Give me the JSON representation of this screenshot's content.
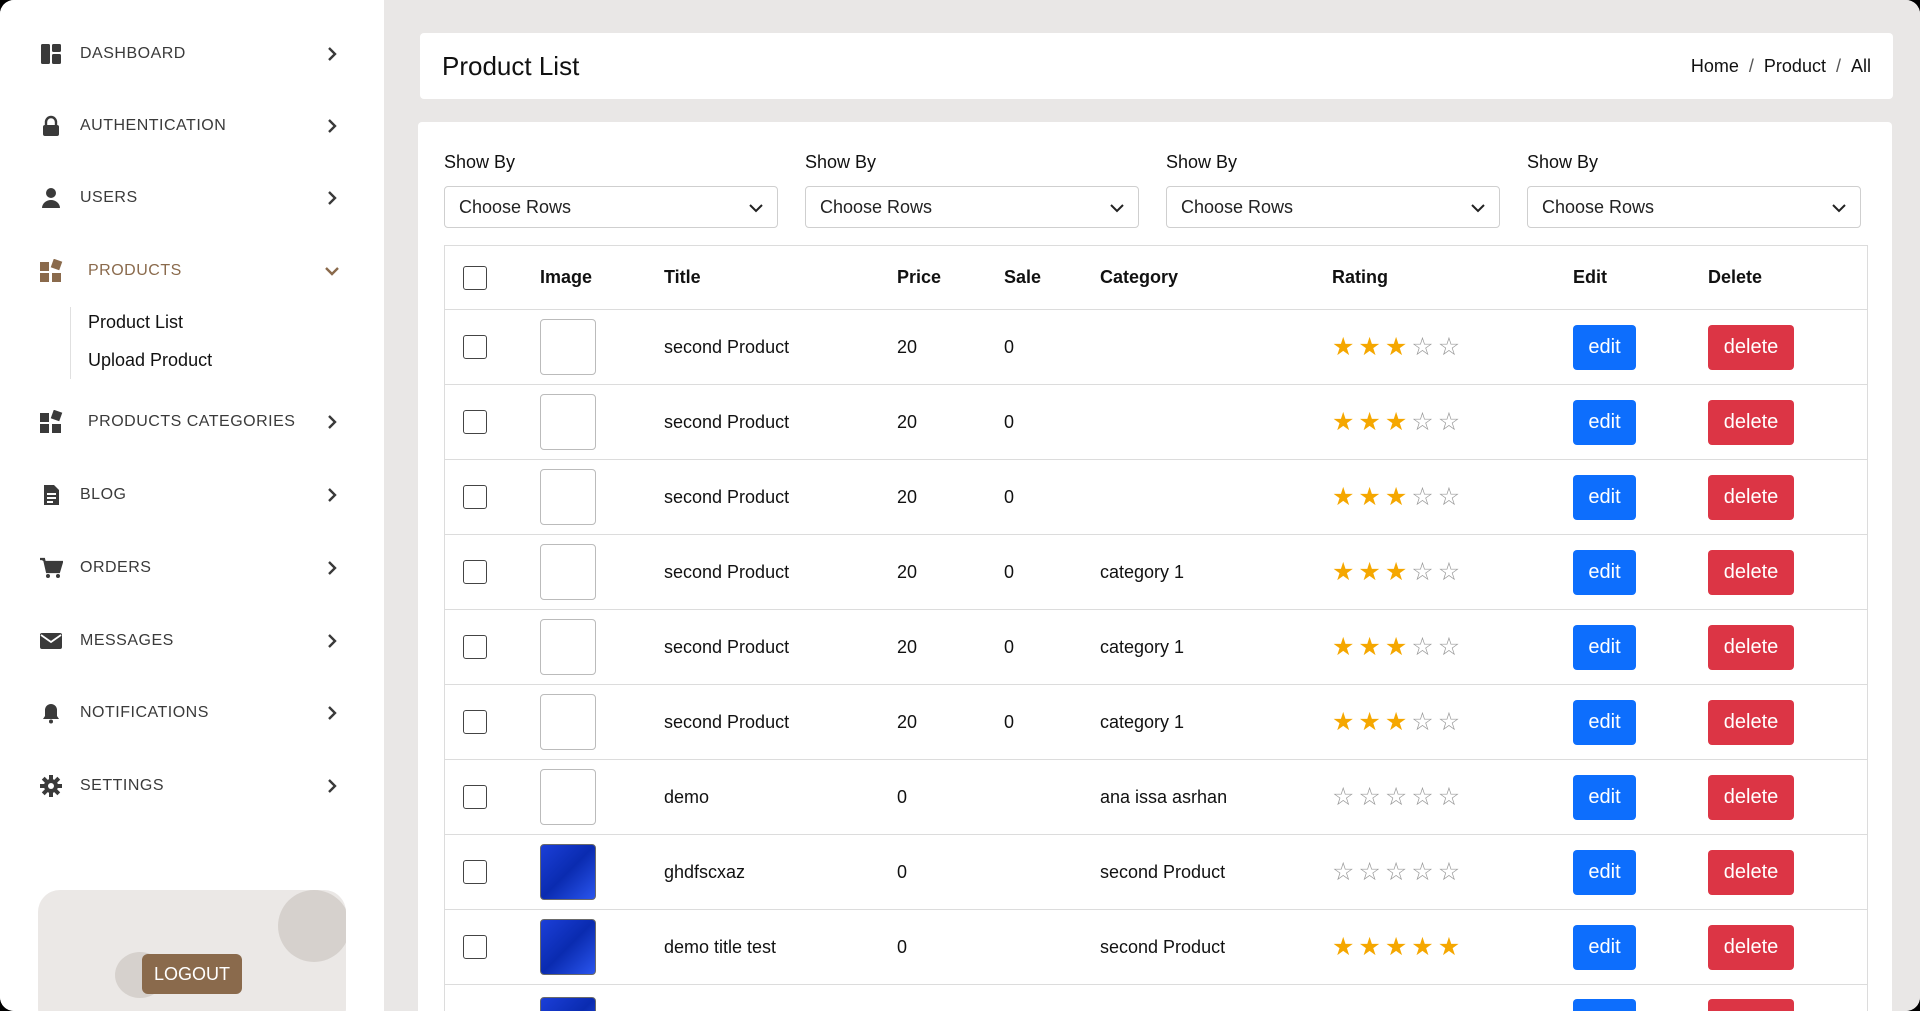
{
  "sidebar": {
    "items": [
      {
        "label": "DASHBOARD",
        "icon": "dashboard-icon"
      },
      {
        "label": "AUTHENTICATION",
        "icon": "lock-icon"
      },
      {
        "label": "USERS",
        "icon": "user-icon"
      },
      {
        "label": "PRODUCTS",
        "icon": "products-icon",
        "active": true
      },
      {
        "label": "PRODUCTS CATEGORIES",
        "icon": "categories-icon"
      },
      {
        "label": "BLOG",
        "icon": "document-icon"
      },
      {
        "label": "ORDERS",
        "icon": "cart-icon"
      },
      {
        "label": "MESSAGES",
        "icon": "envelope-icon"
      },
      {
        "label": "NOTIFICATIONS",
        "icon": "bell-icon"
      },
      {
        "label": "SETTINGS",
        "icon": "gear-icon"
      }
    ],
    "sub_items": [
      "Product List",
      "Upload Product"
    ],
    "logout_label": "LOGOUT"
  },
  "header": {
    "title": "Product List",
    "breadcrumb": [
      "Home",
      "Product",
      "All"
    ]
  },
  "filters": [
    {
      "label": "Show By",
      "value": "Choose Rows"
    },
    {
      "label": "Show By",
      "value": "Choose Rows"
    },
    {
      "label": "Show By",
      "value": "Choose Rows"
    },
    {
      "label": "Show By",
      "value": "Choose Rows"
    }
  ],
  "table": {
    "columns": [
      "Image",
      "Title",
      "Price",
      "Sale",
      "Category",
      "Rating",
      "Edit",
      "Delete"
    ],
    "edit_label": "edit",
    "delete_label": "delete",
    "rows": [
      {
        "title": "second Product",
        "price": "20",
        "sale": "0",
        "category": "",
        "rating": 3,
        "image": "blank"
      },
      {
        "title": "second Product",
        "price": "20",
        "sale": "0",
        "category": "",
        "rating": 3,
        "image": "blank"
      },
      {
        "title": "second Product",
        "price": "20",
        "sale": "0",
        "category": "",
        "rating": 3,
        "image": "blank"
      },
      {
        "title": "second Product",
        "price": "20",
        "sale": "0",
        "category": "category 1",
        "rating": 3,
        "image": "blank"
      },
      {
        "title": "second Product",
        "price": "20",
        "sale": "0",
        "category": "category 1",
        "rating": 3,
        "image": "blank"
      },
      {
        "title": "second Product",
        "price": "20",
        "sale": "0",
        "category": "category 1",
        "rating": 3,
        "image": "blank"
      },
      {
        "title": "demo",
        "price": "0",
        "sale": "",
        "category": "ana issa asrhan",
        "rating": 0,
        "image": "blank"
      },
      {
        "title": "ghdfscxaz",
        "price": "0",
        "sale": "",
        "category": "second Product",
        "rating": 0,
        "image": "blue"
      },
      {
        "title": "demo title test",
        "price": "0",
        "sale": "",
        "category": "second Product",
        "rating": 5,
        "image": "blue"
      }
    ],
    "partial_row_image": "blue"
  },
  "colors": {
    "accent": "#8a6a4c",
    "edit": "#0d6efd",
    "delete": "#dc3545",
    "star": "#f5a700"
  }
}
